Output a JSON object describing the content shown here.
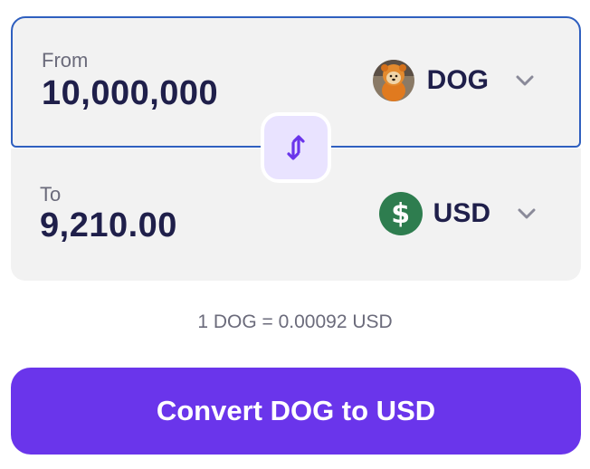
{
  "from": {
    "label": "From",
    "amount": "10,000,000",
    "currency": {
      "code": "DOG",
      "icon": "dog-avatar-icon"
    },
    "dropdown_icon": "chevron-down-icon"
  },
  "to": {
    "label": "To",
    "amount": "9,210.00",
    "currency": {
      "code": "USD",
      "icon": "dollar-coin-icon",
      "symbol": "$",
      "color": "#2e7d4f"
    },
    "dropdown_icon": "chevron-down-icon"
  },
  "swap": {
    "icon": "swap-vertical-icon"
  },
  "rate": "1 DOG = 0.00092 USD",
  "convert_button": {
    "label": "Convert DOG to USD",
    "color": "#6a35eb"
  },
  "colors": {
    "accent": "#6a35eb",
    "focus_border": "#2f5fbf",
    "field_background": "#f2f2f2",
    "text_primary": "#1f1f4a",
    "text_secondary": "#6b6b7b"
  }
}
